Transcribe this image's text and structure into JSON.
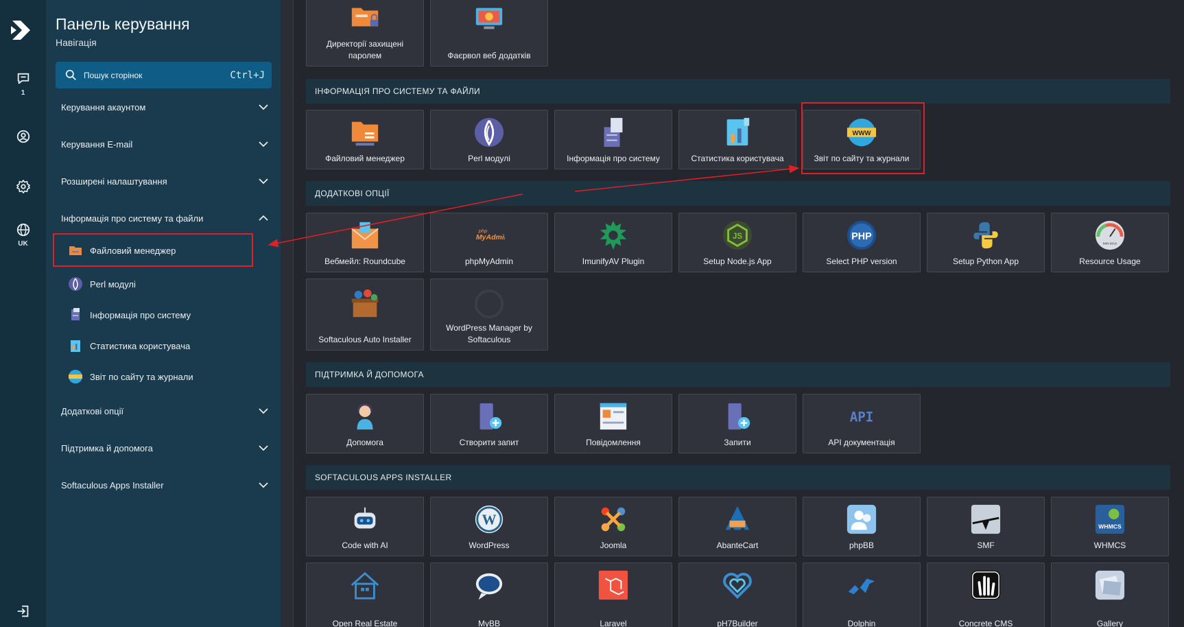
{
  "nav": {
    "title": "Панель керування",
    "subtitle": "Навігація",
    "search_placeholder": "Пошук сторінок",
    "search_shortcut": "Ctrl+J",
    "sections": [
      {
        "label": "Керування акаунтом",
        "icon": "chevron-down-icon"
      },
      {
        "label": "Керування E-mail",
        "icon": "chevron-down-icon"
      },
      {
        "label": "Розширені налаштування",
        "icon": "chevron-down-icon"
      },
      {
        "label": "Інформація про систему та файли",
        "icon": "chevron-up-icon"
      },
      {
        "label": "Додаткові опції",
        "icon": "chevron-down-icon"
      },
      {
        "label": "Підтримка й допомога",
        "icon": "chevron-down-icon"
      },
      {
        "label": "Softaculous Apps Installer",
        "icon": "chevron-down-icon"
      }
    ],
    "sub_items": [
      {
        "label": "Файловий менеджер",
        "icon": "folder-icon"
      },
      {
        "label": "Perl модулі",
        "icon": "onion-icon"
      },
      {
        "label": "Інформація про систему",
        "icon": "server-doc-icon"
      },
      {
        "label": "Статистика користувача",
        "icon": "stats-icon"
      },
      {
        "label": "Звіт по сайту та журнали",
        "icon": "www-globe-icon"
      }
    ]
  },
  "rail": {
    "chat_badge": "1",
    "lang": "UK"
  },
  "main": {
    "top_tiles": [
      "Директорії захищені паролем",
      "Фаєрвол веб додатків"
    ],
    "sections": [
      {
        "header": "ІНФОРМАЦІЯ ПРО СИСТЕМУ ТА ФАЙЛИ",
        "tiles": [
          "Файловий менеджер",
          "Perl модулі",
          "Інформація про систему",
          "Статистика користувача",
          "Звіт по сайту та журнали"
        ]
      },
      {
        "header": "ДОДАТКОВІ ОПЦІЇ",
        "tiles": [
          "Вебмейл: Roundcube",
          "phpMyAdmin",
          "ImunifyAV Plugin",
          "Setup Node.js App",
          "Select PHP version",
          "Setup Python App",
          "Resource Usage",
          "Softaculous Auto Installer",
          "WordPress Manager by Softaculous"
        ]
      },
      {
        "header": "ПІДТРИМКА Й ДОПОМОГА",
        "tiles": [
          "Допомога",
          "Створити запит",
          "Повідомлення",
          "Запити",
          "API документація"
        ]
      },
      {
        "header": "SOFTACULOUS APPS INSTALLER",
        "tiles": [
          "Code with AI",
          "WordPress",
          "Joomla",
          "AbanteCart",
          "phpBB",
          "SMF",
          "WHMCS",
          "Open Real Estate",
          "MyBB",
          "Laravel",
          "pH7Builder",
          "Dolphin",
          "Concrete CMS",
          "Gallery"
        ]
      }
    ],
    "icon_texts": {
      "phpmyadmin_small": "php",
      "phpmyadmin_big": "MyAdmin",
      "php": "PHP",
      "www": "WWW",
      "api": "API",
      "whmcs": "WHMCS",
      "resource": "MIN MAX"
    }
  },
  "colors": {
    "accent": "#0f5c86",
    "nav_bg": "#1a3b4e",
    "rail_bg": "#142f3e",
    "highlight": "#e01f26"
  }
}
